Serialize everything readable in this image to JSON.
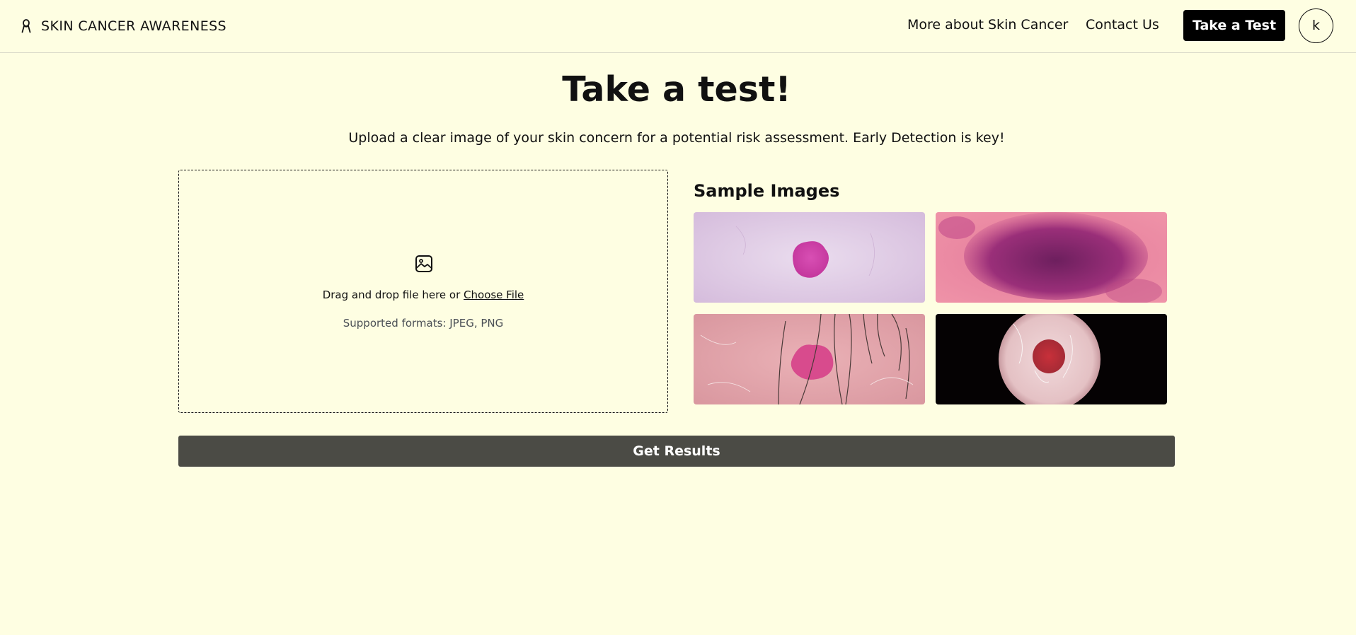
{
  "nav": {
    "brand": "SKIN CANCER AWARENESS",
    "brand_icon": "awareness-ribbon-icon",
    "links": [
      "More about Skin Cancer",
      "Contact Us"
    ],
    "cta": "Take a Test",
    "avatar_initial": "k"
  },
  "main": {
    "title": "Take a test!",
    "subtitle": "Upload a clear image of your skin concern for a potential risk assessment. Early Detection is key!",
    "upload": {
      "icon": "image-icon",
      "drop_text": "Drag and drop file here or ",
      "choose_file": "Choose File",
      "formats": "Supported formats: JPEG, PNG"
    },
    "samples": {
      "heading": "Sample Images"
    },
    "submit": "Get Results"
  },
  "colors": {
    "background": "#fefee2",
    "cta_background": "#000000",
    "submit_background": "#4b4b45"
  }
}
